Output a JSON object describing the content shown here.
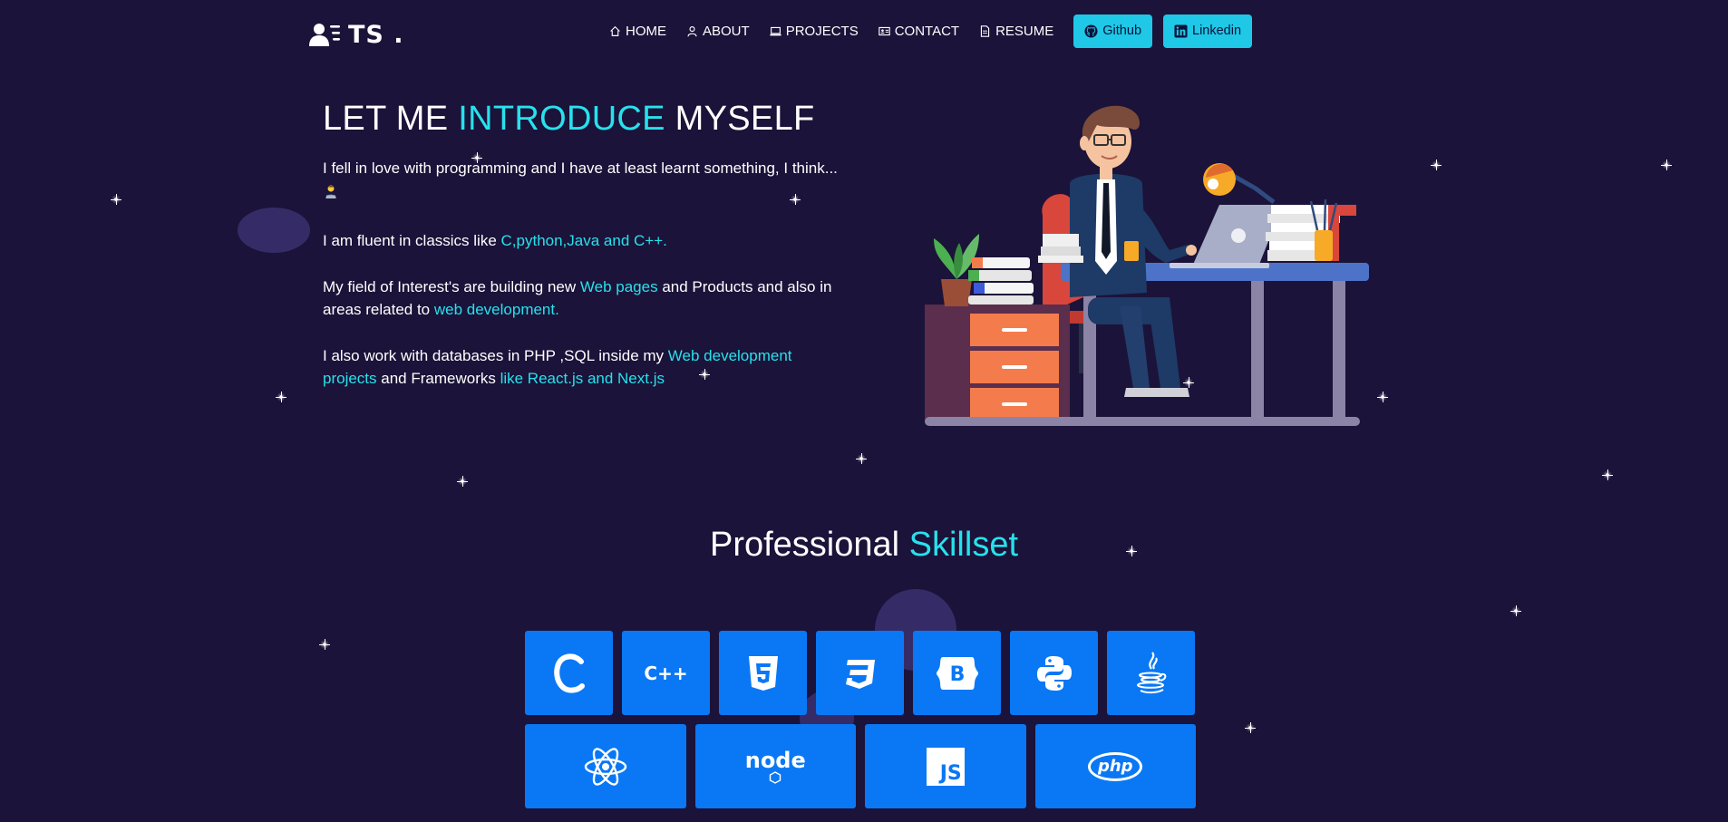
{
  "brand": {
    "logo_text": "TS .",
    "logo_icon": "user-list-icon"
  },
  "nav": {
    "items": [
      {
        "label": "HOME",
        "icon": "home-icon"
      },
      {
        "label": "ABOUT",
        "icon": "user-icon"
      },
      {
        "label": "PROJECTS",
        "icon": "laptop-icon"
      },
      {
        "label": "CONTACT",
        "icon": "contact-card-icon"
      },
      {
        "label": "RESUME",
        "icon": "document-icon"
      }
    ],
    "buttons": [
      {
        "label": "Github",
        "icon": "github-icon"
      },
      {
        "label": "Linkedin",
        "icon": "linkedin-icon"
      }
    ]
  },
  "intro": {
    "title_pre": "LET ME ",
    "title_accent": "INTRODUCE",
    "title_post": " MYSELF",
    "p1": "I fell in love with programming and I have at least learnt something, I think...",
    "p2_pre": "I am fluent in classics like ",
    "p2_accent": "C,python,Java and C++.",
    "p3_pre": "My field of Interest's are building new ",
    "p3_accent1": "Web pages",
    "p3_mid": " and Products and also in areas related to ",
    "p3_accent2": "web development.",
    "p4_pre": "I also work with databases in PHP ,SQL inside my ",
    "p4_accent1": "Web development projects",
    "p4_mid": " and Frameworks ",
    "p4_accent2": "like React.js and Next.js"
  },
  "skills": {
    "title_pre": "Professional ",
    "title_accent": "Skillset",
    "row1": [
      {
        "name": "c-icon",
        "label": "C"
      },
      {
        "name": "cpp-icon",
        "label": "C++"
      },
      {
        "name": "html5-icon",
        "label": "5"
      },
      {
        "name": "css3-icon",
        "label": "3"
      },
      {
        "name": "bootstrap-icon",
        "label": "B"
      },
      {
        "name": "python-icon"
      },
      {
        "name": "java-icon"
      }
    ],
    "row2": [
      {
        "name": "react-icon"
      },
      {
        "name": "nodejs-icon",
        "label": "node"
      },
      {
        "name": "javascript-icon",
        "label": "JS"
      },
      {
        "name": "php-icon",
        "label": "php"
      }
    ]
  },
  "colors": {
    "background": "#1b1339",
    "accent": "#27e1ec",
    "button": "#1ec8e6",
    "tile": "#0a78f5"
  }
}
